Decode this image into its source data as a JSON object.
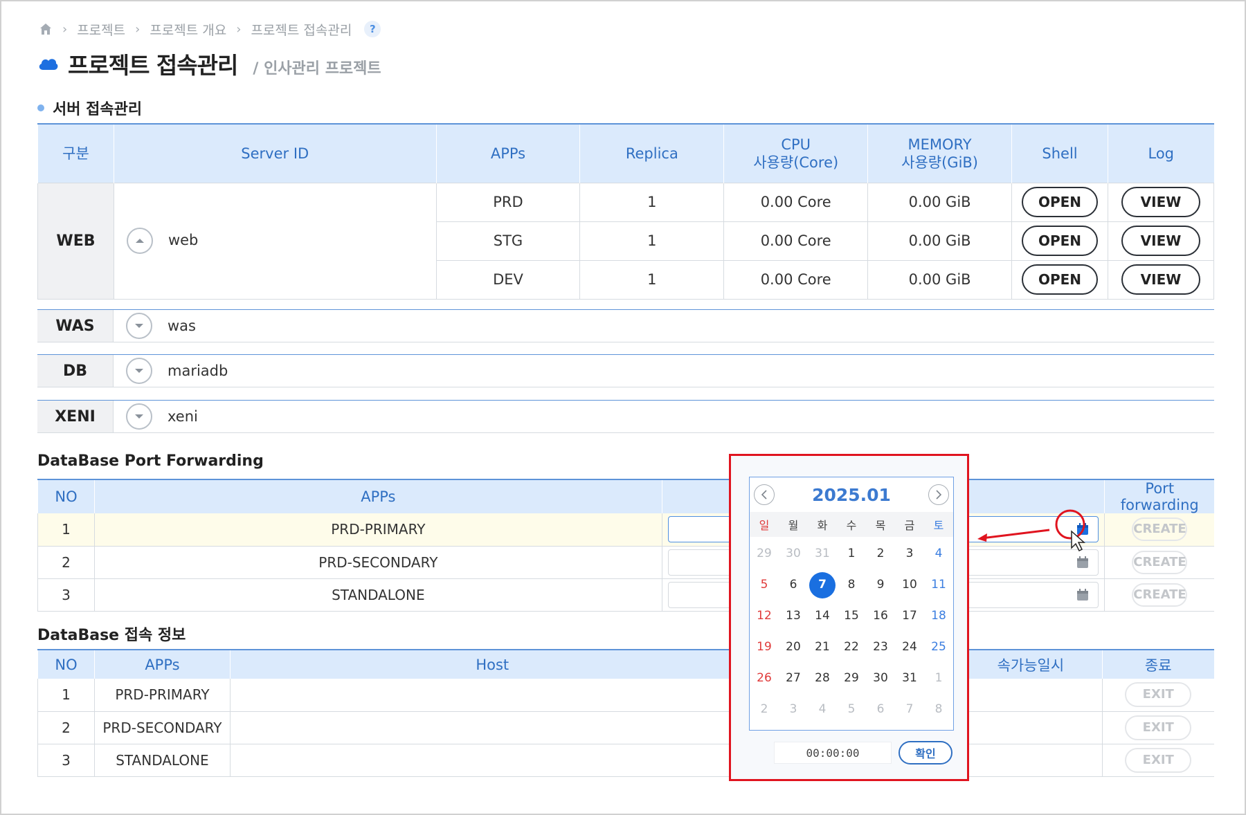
{
  "breadcrumb": {
    "items": [
      "프로젝트",
      "프로젝트 개요",
      "프로젝트 접속관리"
    ],
    "help": "?"
  },
  "page": {
    "title": "프로젝트 접속관리",
    "subtitle": "/ 인사관리 프로젝트"
  },
  "server_section": {
    "title": "서버 접속관리",
    "headers": [
      "구분",
      "Server ID",
      "APPs",
      "Replica",
      "CPU",
      "사용량(Core)",
      "MEMORY",
      "사용량(GiB)",
      "Shell",
      "Log"
    ],
    "web": {
      "category": "WEB",
      "server_id": "web",
      "rows": [
        {
          "app": "PRD",
          "replica": "1",
          "cpu": "0.00 Core",
          "memory": "0.00 GiB",
          "shell": "OPEN",
          "log": "VIEW"
        },
        {
          "app": "STG",
          "replica": "1",
          "cpu": "0.00 Core",
          "memory": "0.00 GiB",
          "shell": "OPEN",
          "log": "VIEW"
        },
        {
          "app": "DEV",
          "replica": "1",
          "cpu": "0.00 Core",
          "memory": "0.00 GiB",
          "shell": "OPEN",
          "log": "VIEW"
        }
      ]
    },
    "collapsed": [
      {
        "category": "WAS",
        "server_id": "was"
      },
      {
        "category": "DB",
        "server_id": "mariadb"
      },
      {
        "category": "XENI",
        "server_id": "xeni"
      }
    ]
  },
  "port_forwarding": {
    "title": "DataBase Port Forwarding",
    "headers": [
      "NO",
      "APPs",
      "Port forwarding"
    ],
    "rows": [
      {
        "no": "1",
        "app": "PRD-PRIMARY",
        "action": "CREATE"
      },
      {
        "no": "2",
        "app": "PRD-SECONDARY",
        "action": "CREATE"
      },
      {
        "no": "3",
        "app": "STANDALONE",
        "action": "CREATE"
      }
    ]
  },
  "db_info": {
    "title": "DataBase 접속 정보",
    "headers": [
      "NO",
      "APPs",
      "Host",
      "속가능일시",
      "종료"
    ],
    "rows": [
      {
        "no": "1",
        "app": "PRD-PRIMARY",
        "action": "EXIT"
      },
      {
        "no": "2",
        "app": "PRD-SECONDARY",
        "action": "EXIT"
      },
      {
        "no": "3",
        "app": "STANDALONE",
        "action": "EXIT"
      }
    ]
  },
  "calendar": {
    "month_label": "2025.01",
    "weekdays": [
      "일",
      "월",
      "화",
      "수",
      "목",
      "금",
      "토"
    ],
    "weeks": [
      [
        "29",
        "30",
        "31",
        "1",
        "2",
        "3",
        "4"
      ],
      [
        "5",
        "6",
        "7",
        "8",
        "9",
        "10",
        "11"
      ],
      [
        "12",
        "13",
        "14",
        "15",
        "16",
        "17",
        "18"
      ],
      [
        "19",
        "20",
        "21",
        "22",
        "23",
        "24",
        "25"
      ],
      [
        "26",
        "27",
        "28",
        "29",
        "30",
        "31",
        "1"
      ],
      [
        "2",
        "3",
        "4",
        "5",
        "6",
        "7",
        "8"
      ]
    ],
    "selected_day": "7",
    "time": "00:00:00",
    "confirm_label": "확인"
  },
  "colors": {
    "accent": "#2f6fc2",
    "header_bg": "#dbeafc",
    "highlight_row": "#fefcea",
    "annotation_red": "#e0141f"
  }
}
